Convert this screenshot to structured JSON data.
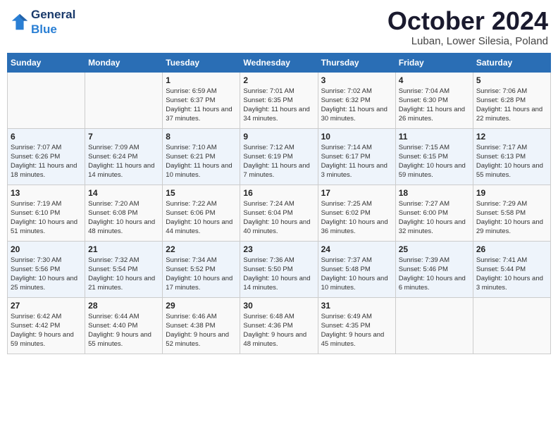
{
  "header": {
    "logo_general": "General",
    "logo_blue": "Blue",
    "month_title": "October 2024",
    "subtitle": "Luban, Lower Silesia, Poland"
  },
  "weekdays": [
    "Sunday",
    "Monday",
    "Tuesday",
    "Wednesday",
    "Thursday",
    "Friday",
    "Saturday"
  ],
  "weeks": [
    [
      {
        "day": "",
        "sunrise": "",
        "sunset": "",
        "daylight": ""
      },
      {
        "day": "",
        "sunrise": "",
        "sunset": "",
        "daylight": ""
      },
      {
        "day": "1",
        "sunrise": "Sunrise: 6:59 AM",
        "sunset": "Sunset: 6:37 PM",
        "daylight": "Daylight: 11 hours and 37 minutes."
      },
      {
        "day": "2",
        "sunrise": "Sunrise: 7:01 AM",
        "sunset": "Sunset: 6:35 PM",
        "daylight": "Daylight: 11 hours and 34 minutes."
      },
      {
        "day": "3",
        "sunrise": "Sunrise: 7:02 AM",
        "sunset": "Sunset: 6:32 PM",
        "daylight": "Daylight: 11 hours and 30 minutes."
      },
      {
        "day": "4",
        "sunrise": "Sunrise: 7:04 AM",
        "sunset": "Sunset: 6:30 PM",
        "daylight": "Daylight: 11 hours and 26 minutes."
      },
      {
        "day": "5",
        "sunrise": "Sunrise: 7:06 AM",
        "sunset": "Sunset: 6:28 PM",
        "daylight": "Daylight: 11 hours and 22 minutes."
      }
    ],
    [
      {
        "day": "6",
        "sunrise": "Sunrise: 7:07 AM",
        "sunset": "Sunset: 6:26 PM",
        "daylight": "Daylight: 11 hours and 18 minutes."
      },
      {
        "day": "7",
        "sunrise": "Sunrise: 7:09 AM",
        "sunset": "Sunset: 6:24 PM",
        "daylight": "Daylight: 11 hours and 14 minutes."
      },
      {
        "day": "8",
        "sunrise": "Sunrise: 7:10 AM",
        "sunset": "Sunset: 6:21 PM",
        "daylight": "Daylight: 11 hours and 10 minutes."
      },
      {
        "day": "9",
        "sunrise": "Sunrise: 7:12 AM",
        "sunset": "Sunset: 6:19 PM",
        "daylight": "Daylight: 11 hours and 7 minutes."
      },
      {
        "day": "10",
        "sunrise": "Sunrise: 7:14 AM",
        "sunset": "Sunset: 6:17 PM",
        "daylight": "Daylight: 11 hours and 3 minutes."
      },
      {
        "day": "11",
        "sunrise": "Sunrise: 7:15 AM",
        "sunset": "Sunset: 6:15 PM",
        "daylight": "Daylight: 10 hours and 59 minutes."
      },
      {
        "day": "12",
        "sunrise": "Sunrise: 7:17 AM",
        "sunset": "Sunset: 6:13 PM",
        "daylight": "Daylight: 10 hours and 55 minutes."
      }
    ],
    [
      {
        "day": "13",
        "sunrise": "Sunrise: 7:19 AM",
        "sunset": "Sunset: 6:10 PM",
        "daylight": "Daylight: 10 hours and 51 minutes."
      },
      {
        "day": "14",
        "sunrise": "Sunrise: 7:20 AM",
        "sunset": "Sunset: 6:08 PM",
        "daylight": "Daylight: 10 hours and 48 minutes."
      },
      {
        "day": "15",
        "sunrise": "Sunrise: 7:22 AM",
        "sunset": "Sunset: 6:06 PM",
        "daylight": "Daylight: 10 hours and 44 minutes."
      },
      {
        "day": "16",
        "sunrise": "Sunrise: 7:24 AM",
        "sunset": "Sunset: 6:04 PM",
        "daylight": "Daylight: 10 hours and 40 minutes."
      },
      {
        "day": "17",
        "sunrise": "Sunrise: 7:25 AM",
        "sunset": "Sunset: 6:02 PM",
        "daylight": "Daylight: 10 hours and 36 minutes."
      },
      {
        "day": "18",
        "sunrise": "Sunrise: 7:27 AM",
        "sunset": "Sunset: 6:00 PM",
        "daylight": "Daylight: 10 hours and 32 minutes."
      },
      {
        "day": "19",
        "sunrise": "Sunrise: 7:29 AM",
        "sunset": "Sunset: 5:58 PM",
        "daylight": "Daylight: 10 hours and 29 minutes."
      }
    ],
    [
      {
        "day": "20",
        "sunrise": "Sunrise: 7:30 AM",
        "sunset": "Sunset: 5:56 PM",
        "daylight": "Daylight: 10 hours and 25 minutes."
      },
      {
        "day": "21",
        "sunrise": "Sunrise: 7:32 AM",
        "sunset": "Sunset: 5:54 PM",
        "daylight": "Daylight: 10 hours and 21 minutes."
      },
      {
        "day": "22",
        "sunrise": "Sunrise: 7:34 AM",
        "sunset": "Sunset: 5:52 PM",
        "daylight": "Daylight: 10 hours and 17 minutes."
      },
      {
        "day": "23",
        "sunrise": "Sunrise: 7:36 AM",
        "sunset": "Sunset: 5:50 PM",
        "daylight": "Daylight: 10 hours and 14 minutes."
      },
      {
        "day": "24",
        "sunrise": "Sunrise: 7:37 AM",
        "sunset": "Sunset: 5:48 PM",
        "daylight": "Daylight: 10 hours and 10 minutes."
      },
      {
        "day": "25",
        "sunrise": "Sunrise: 7:39 AM",
        "sunset": "Sunset: 5:46 PM",
        "daylight": "Daylight: 10 hours and 6 minutes."
      },
      {
        "day": "26",
        "sunrise": "Sunrise: 7:41 AM",
        "sunset": "Sunset: 5:44 PM",
        "daylight": "Daylight: 10 hours and 3 minutes."
      }
    ],
    [
      {
        "day": "27",
        "sunrise": "Sunrise: 6:42 AM",
        "sunset": "Sunset: 4:42 PM",
        "daylight": "Daylight: 9 hours and 59 minutes."
      },
      {
        "day": "28",
        "sunrise": "Sunrise: 6:44 AM",
        "sunset": "Sunset: 4:40 PM",
        "daylight": "Daylight: 9 hours and 55 minutes."
      },
      {
        "day": "29",
        "sunrise": "Sunrise: 6:46 AM",
        "sunset": "Sunset: 4:38 PM",
        "daylight": "Daylight: 9 hours and 52 minutes."
      },
      {
        "day": "30",
        "sunrise": "Sunrise: 6:48 AM",
        "sunset": "Sunset: 4:36 PM",
        "daylight": "Daylight: 9 hours and 48 minutes."
      },
      {
        "day": "31",
        "sunrise": "Sunrise: 6:49 AM",
        "sunset": "Sunset: 4:35 PM",
        "daylight": "Daylight: 9 hours and 45 minutes."
      },
      {
        "day": "",
        "sunrise": "",
        "sunset": "",
        "daylight": ""
      },
      {
        "day": "",
        "sunrise": "",
        "sunset": "",
        "daylight": ""
      }
    ]
  ]
}
